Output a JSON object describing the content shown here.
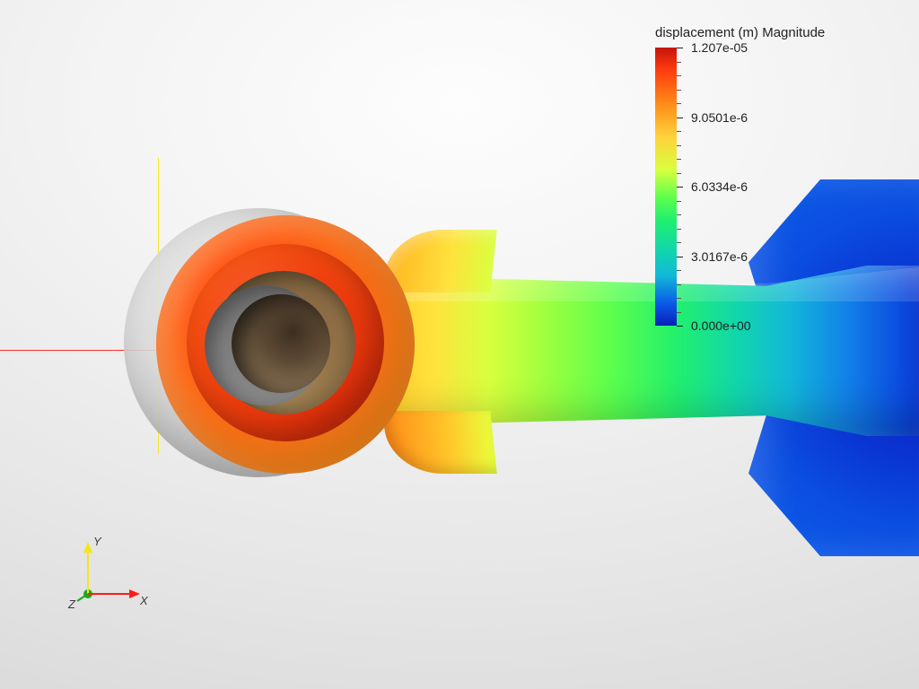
{
  "legend": {
    "title": "displacement (m) Magnitude",
    "max_label": "1.207e-05",
    "q3_label": "9.0501e-6",
    "mid_label": "6.0334e-6",
    "q1_label": "3.0167e-6",
    "min_label": "0.000e+00"
  },
  "triad": {
    "x_label": "X",
    "y_label": "Y",
    "z_label": "Z"
  },
  "colormap": {
    "name": "rainbow",
    "min_color": "#081fb8",
    "max_color": "#c6140a"
  },
  "chart_data": {
    "type": "heatmap",
    "title": "displacement (m) Magnitude",
    "field": "displacement_magnitude",
    "unit": "m",
    "range": [
      0.0,
      1.207e-05
    ],
    "legend_ticks": [
      {
        "value": 1.207e-05,
        "label": "1.207e-05"
      },
      {
        "value": 9.0501e-06,
        "label": "9.0501e-6"
      },
      {
        "value": 6.0334e-06,
        "label": "6.0334e-6"
      },
      {
        "value": 3.0167e-06,
        "label": "3.0167e-6"
      },
      {
        "value": 0.0,
        "label": "0.000e+00"
      }
    ],
    "colormap": "rainbow (blue→red)",
    "geometry": "connecting-rod small end with bore, shank, big-end flare",
    "overlay": "undeformed reference mesh shown semi-transparent at small end",
    "qualitative_distribution": {
      "small_end_hub": "≈1.0e-05–1.207e-05 (red/orange, maximum)",
      "hub_to_shank_fillet": "≈7e-06–1.0e-05 (orange→yellow)",
      "shank_mid": "≈3e-06–7e-06 (green)",
      "shank_near_big_end": "≈0–3e-06 (cyan→blue)",
      "big_end": "≈0 (deep blue, constrained)"
    }
  }
}
